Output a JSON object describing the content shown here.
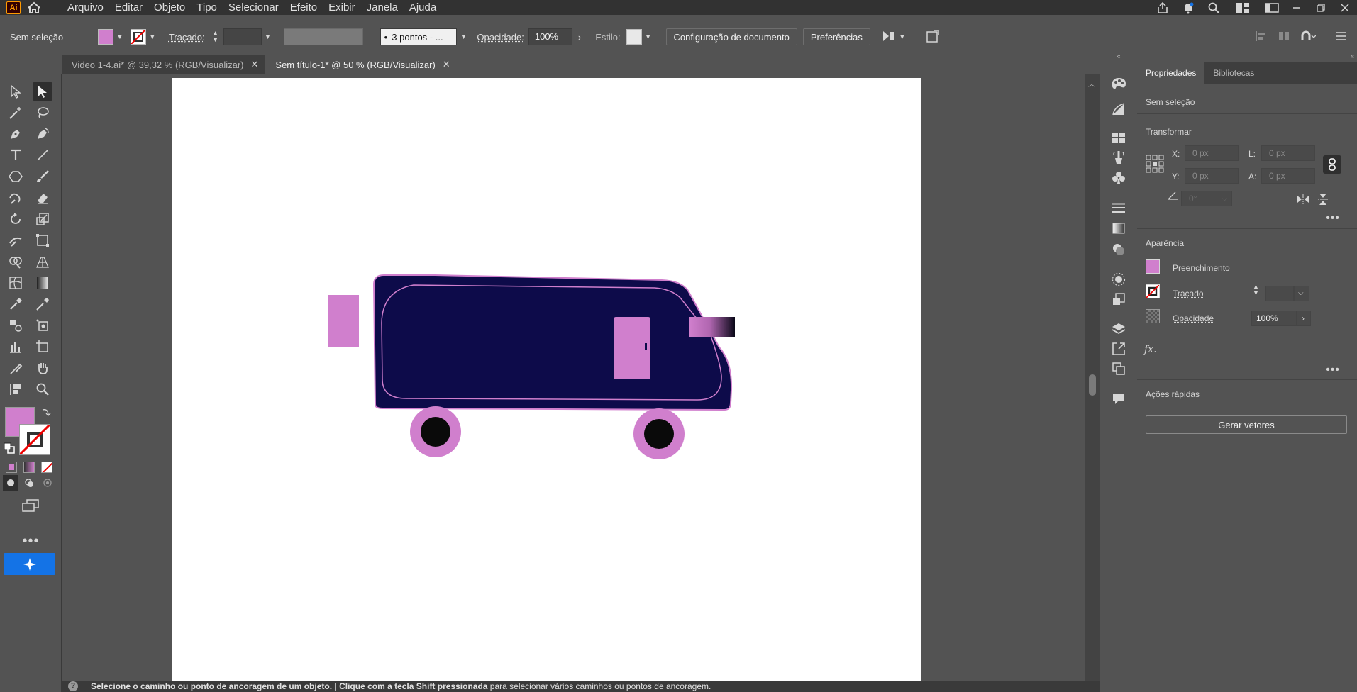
{
  "menubar": {
    "app_logo": "Ai",
    "items": [
      "Arquivo",
      "Editar",
      "Objeto",
      "Tipo",
      "Selecionar",
      "Efeito",
      "Exibir",
      "Janela",
      "Ajuda"
    ]
  },
  "controlbar": {
    "selection_status": "Sem seleção",
    "stroke_label": "Traçado:",
    "brush_profile": "3 pontos - ...",
    "opacity_label": "Opacidade:",
    "opacity_value": "100%",
    "style_label": "Estilo:",
    "doc_setup_button": "Configuração de documento",
    "preferences_button": "Preferências"
  },
  "tabs": [
    {
      "label": "Video  1-4.ai* @ 39,32 % (RGB/Visualizar)",
      "active": false
    },
    {
      "label": "Sem título-1* @ 50 % (RGB/Visualizar)",
      "active": true
    }
  ],
  "colors": {
    "fill": "#d07fcd",
    "van_body": "#0d0b4a",
    "van_outline": "#d07fcd",
    "tire_inner": "#0a0a0a",
    "accent_blue": "#1473e6"
  },
  "status_bar": {
    "text_bold": "Selecione o caminho ou ponto de ancoragem de um objeto. | Clique com a tecla Shift pressionada",
    "text_rest": " para selecionar vários caminhos ou pontos de ancoragem."
  },
  "properties": {
    "tabs": [
      "Propriedades",
      "Bibliotecas"
    ],
    "selection": "Sem seleção",
    "transform_heading": "Transformar",
    "x_label": "X:",
    "x_value": "0 px",
    "y_label": "Y:",
    "y_value": "0 px",
    "w_label": "L:",
    "w_value": "0 px",
    "h_label": "A:",
    "h_value": "0 px",
    "angle_value": "0°",
    "appearance_heading": "Aparência",
    "fill_label": "Preenchimento",
    "stroke_label": "Traçado",
    "opacity_label": "Opacidade",
    "opacity_value": "100%",
    "fx_label": "fx.",
    "quick_actions_heading": "Ações rápidas",
    "generate_vectors_button": "Gerar vetores"
  }
}
